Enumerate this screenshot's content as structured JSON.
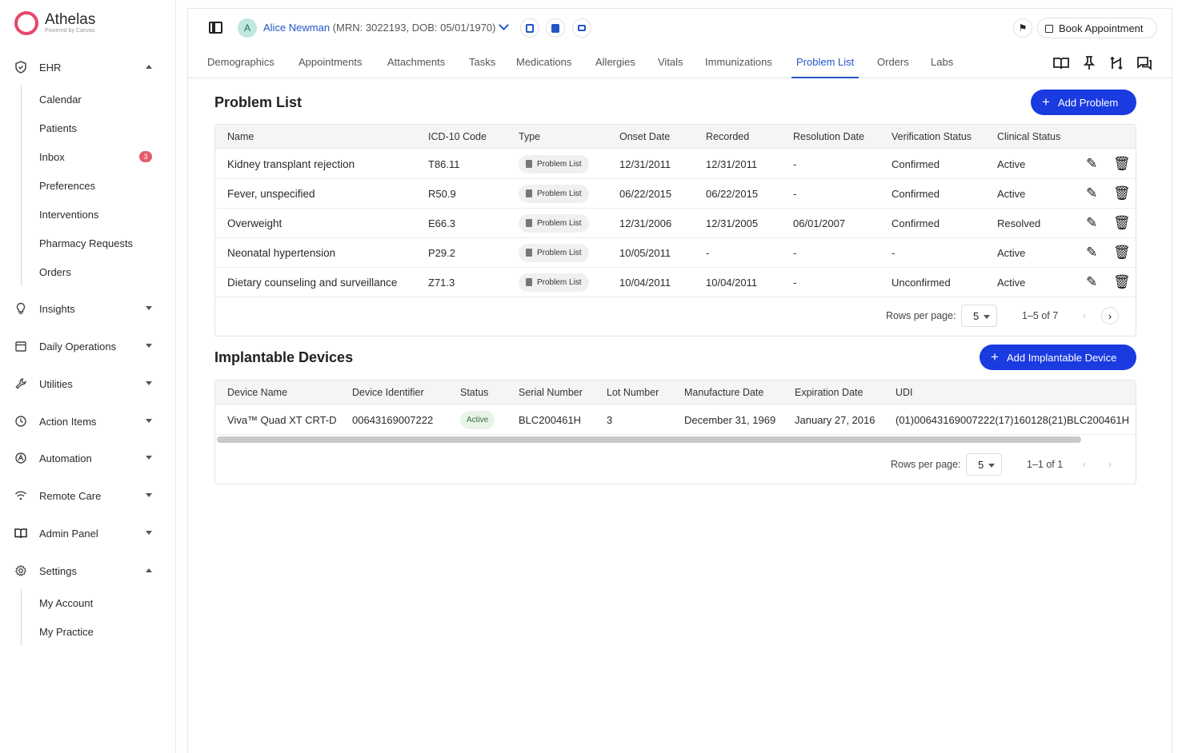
{
  "app": {
    "name": "Athelas",
    "tagline": "Powered by Canvas"
  },
  "sidebar": {
    "groups": [
      {
        "label": "EHR",
        "icon": "shield-icon",
        "expanded": true
      },
      {
        "label": "Insights",
        "icon": "lightbulb-icon",
        "expanded": false
      },
      {
        "label": "Daily Operations",
        "icon": "calendar-icon",
        "expanded": false
      },
      {
        "label": "Utilities",
        "icon": "wrench-icon",
        "expanded": false
      },
      {
        "label": "Action Items",
        "icon": "clock-icon",
        "expanded": false
      },
      {
        "label": "Automation",
        "icon": "automation-icon",
        "expanded": false
      },
      {
        "label": "Remote Care",
        "icon": "wifi-icon",
        "expanded": false
      },
      {
        "label": "Admin Panel",
        "icon": "book-icon",
        "expanded": false
      },
      {
        "label": "Settings",
        "icon": "gear-icon",
        "expanded": true
      }
    ],
    "ehr_items": [
      "Calendar",
      "Patients",
      "Inbox",
      "Preferences",
      "Interventions",
      "Pharmacy Requests",
      "Orders"
    ],
    "inbox_badge": "3",
    "settings_items": [
      "My Account",
      "My Practice"
    ]
  },
  "header": {
    "avatar_initial": "A",
    "patient_name": "Alice Newman",
    "patient_meta": " (MRN: 3022193, DOB: 05/01/1970)",
    "book_label": "Book Appointment"
  },
  "tabs": [
    "Demographics",
    "Appointments",
    "Attachments",
    "Tasks",
    "Medications",
    "Allergies",
    "Vitals",
    "Immunizations",
    "Problem List",
    "Orders",
    "Labs"
  ],
  "active_tab": "Problem List",
  "problems": {
    "title": "Problem List",
    "add_label": "Add Problem",
    "columns": [
      "Name",
      "ICD-10 Code",
      "Type",
      "Onset Date",
      "Recorded",
      "Resolution Date",
      "Verification Status",
      "Clinical Status"
    ],
    "rows": [
      {
        "name": "Kidney transplant rejection",
        "code": "T86.11",
        "type": "Problem List",
        "onset": "12/31/2011",
        "recorded": "12/31/2011",
        "resolution": "-",
        "verification": "Confirmed",
        "clinical": "Active"
      },
      {
        "name": "Fever, unspecified",
        "code": "R50.9",
        "type": "Problem List",
        "onset": "06/22/2015",
        "recorded": "06/22/2015",
        "resolution": "-",
        "verification": "Confirmed",
        "clinical": "Active"
      },
      {
        "name": "Overweight",
        "code": "E66.3",
        "type": "Problem List",
        "onset": "12/31/2006",
        "recorded": "12/31/2005",
        "resolution": "06/01/2007",
        "verification": "Confirmed",
        "clinical": "Resolved"
      },
      {
        "name": "Neonatal hypertension",
        "code": "P29.2",
        "type": "Problem List",
        "onset": "10/05/2011",
        "recorded": "-",
        "resolution": "-",
        "verification": "-",
        "clinical": "Active"
      },
      {
        "name": "Dietary counseling and surveillance",
        "code": "Z71.3",
        "type": "Problem List",
        "onset": "10/04/2011",
        "recorded": "10/04/2011",
        "resolution": "-",
        "verification": "Unconfirmed",
        "clinical": "Active"
      }
    ],
    "rows_per_page_label": "Rows per page:",
    "rows_per_page": "5",
    "range": "1–5 of 7"
  },
  "devices": {
    "title": "Implantable Devices",
    "add_label": "Add Implantable Device",
    "columns": [
      "Device Name",
      "Device Identifier",
      "Status",
      "Serial Number",
      "Lot Number",
      "Manufacture Date",
      "Expiration Date",
      "UDI"
    ],
    "rows": [
      {
        "name": "Viva™ Quad XT CRT-D",
        "identifier": "00643169007222",
        "status": "Active",
        "serial": "BLC200461H",
        "lot": "3",
        "manufacture": "December 31, 1969",
        "expiration": "January 27, 2016",
        "udi": "(01)00643169007222(17)160128(21)BLC200461H"
      }
    ],
    "rows_per_page_label": "Rows per page:",
    "rows_per_page": "5",
    "range": "1–1 of 1"
  },
  "icons": {
    "edit": "✎",
    "delete": "🗑",
    "prev": "‹",
    "next": "›"
  },
  "colors": {
    "primary": "#1a3be0",
    "link": "#2356c7",
    "brand": "#e8476b",
    "badge": "#e35d6a"
  }
}
